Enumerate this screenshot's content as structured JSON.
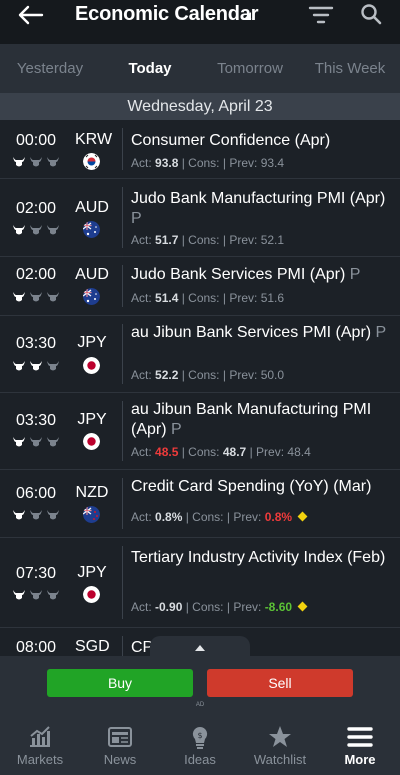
{
  "header": {
    "title": "Economic Calendar"
  },
  "day_tabs": [
    {
      "label": "Yesterday",
      "active": false
    },
    {
      "label": "Today",
      "active": true
    },
    {
      "label": "Tomorrow",
      "active": false
    },
    {
      "label": "This Week",
      "active": false
    }
  ],
  "date_header": "Wednesday, April 23",
  "labels": {
    "act": "Act:",
    "cons": "| Cons:",
    "prev": "| Prev:"
  },
  "events": [
    {
      "time": "00:00",
      "currency": "KRW",
      "name": "Consumer Confidence (Apr)",
      "prelim": "",
      "act": "93.8",
      "cons": "",
      "prev": "93.4",
      "act_color": "",
      "prev_color": "",
      "impact": 1,
      "flag": "kr-flag",
      "diamond": false
    },
    {
      "time": "02:00",
      "currency": "AUD",
      "name": "Judo Bank Manufacturing PMI (Apr)",
      "prelim": "P",
      "act": "51.7",
      "cons": "",
      "prev": "52.1",
      "act_color": "",
      "prev_color": "",
      "impact": 1,
      "flag": "au-flag",
      "diamond": false
    },
    {
      "time": "02:00",
      "currency": "AUD",
      "name": "Judo Bank Services PMI (Apr)",
      "prelim": "P",
      "act": "51.4",
      "cons": "",
      "prev": "51.6",
      "act_color": "",
      "prev_color": "",
      "impact": 1,
      "flag": "au-flag",
      "diamond": false
    },
    {
      "time": "03:30",
      "currency": "JPY",
      "name": "au Jibun Bank Services PMI (Apr)",
      "prelim": "P",
      "act": "52.2",
      "cons": "",
      "prev": "50.0",
      "act_color": "",
      "prev_color": "",
      "impact": 1,
      "flag": "jp-flag",
      "diamond": false
    },
    {
      "time": "03:30",
      "currency": "JPY",
      "name": "au Jibun Bank Manufacturing PMI (Apr)",
      "prelim": "P",
      "act": "48.5",
      "cons": "48.7",
      "prev": "48.4",
      "act_color": "red",
      "prev_color": "",
      "impact": 1,
      "flag": "jp-flag",
      "diamond": false
    },
    {
      "time": "06:00",
      "currency": "NZD",
      "name": "Credit Card Spending (YoY) (Mar)",
      "prelim": "",
      "act": "0.8%",
      "cons": "",
      "prev": "0.8%",
      "act_color": "",
      "prev_color": "red",
      "impact": 1,
      "flag": "nz-flag",
      "diamond": true
    },
    {
      "time": "07:30",
      "currency": "JPY",
      "name": "Tertiary Industry Activity Index (Feb)",
      "prelim": "",
      "act": "-0.90",
      "cons": "",
      "prev": "-8.60",
      "act_color": "",
      "prev_color": "green",
      "impact": 1,
      "flag": "jp-flag",
      "diamond": true
    },
    {
      "time": "08:00",
      "currency": "SGD",
      "name": "CPI",
      "prelim": "",
      "act": "",
      "cons": "",
      "prev": "",
      "act_color": "",
      "prev_color": "",
      "impact": 1,
      "flag": "sg-flag",
      "diamond": false
    }
  ],
  "trade": {
    "buy_label": "Buy",
    "sell_label": "Sell",
    "ad_tag": "AD"
  },
  "nav": [
    {
      "label": "Markets",
      "icon": "chart-icon",
      "active": false
    },
    {
      "label": "News",
      "icon": "newspaper-icon",
      "active": false
    },
    {
      "label": "Ideas",
      "icon": "lightbulb-icon",
      "active": false
    },
    {
      "label": "Watchlist",
      "icon": "star-icon",
      "active": false
    },
    {
      "label": "More",
      "icon": "menu-icon",
      "active": true
    }
  ],
  "colors": {
    "accent_red": "#ee3b3b",
    "accent_green": "#5bc236",
    "buy": "#21a426",
    "sell": "#cf3a2c",
    "diamond": "#f2d20e"
  }
}
